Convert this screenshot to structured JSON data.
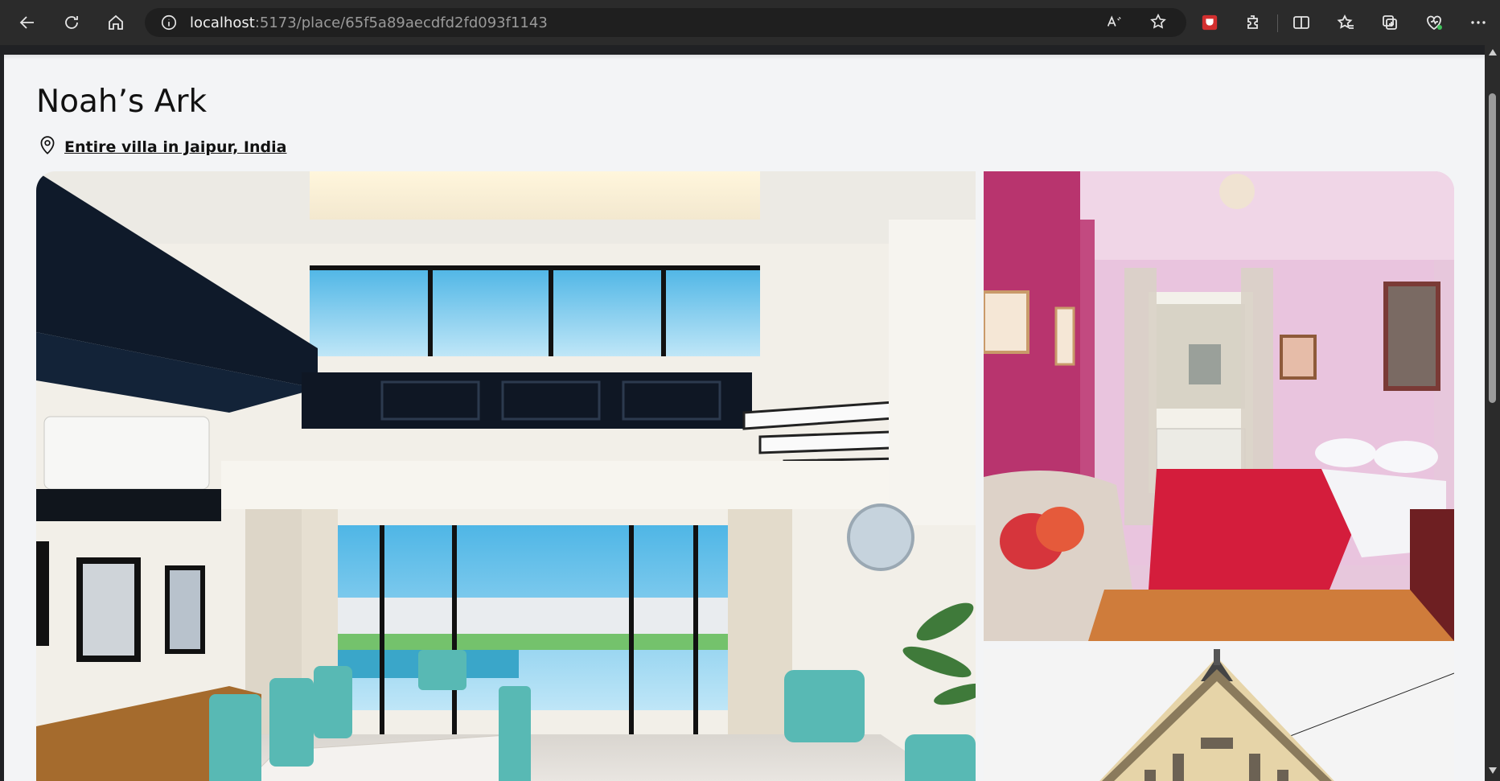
{
  "browser": {
    "url_host": "localhost",
    "url_rest": ":5173/place/65f5a89aecdfd2fd093f1143",
    "icons": [
      "back-icon",
      "reload-icon",
      "home-icon",
      "info-icon",
      "read-aloud-icon",
      "favorite-star-icon",
      "extension-red-icon",
      "extensions-icon",
      "split-screen-icon",
      "favorites-icon",
      "collections-icon",
      "browser-essentials-icon",
      "more-icon"
    ]
  },
  "place": {
    "title": "Noah’s Ark",
    "location": "Entire villa in Jaipur, India"
  },
  "gallery": {
    "photos": [
      "villa-living-room-photo",
      "pink-bedroom-photo",
      "building-facade-photo"
    ]
  },
  "colors": {
    "page_bg": "#f3f4f6",
    "chrome_bg": "#2b2b2b"
  }
}
